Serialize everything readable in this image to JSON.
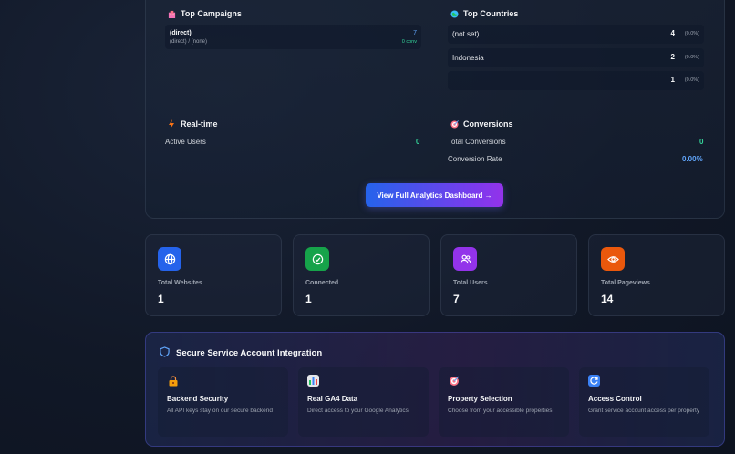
{
  "analytics": {
    "top_campaigns": {
      "title": "Top Campaigns",
      "rows": [
        {
          "name": "(direct)",
          "source": "(direct) / (none)",
          "value": "7",
          "conversions": "0 conv"
        }
      ]
    },
    "top_countries": {
      "title": "Top Countries",
      "rows": [
        {
          "name": "(not set)",
          "value": "4",
          "pct": "(0.0%)"
        },
        {
          "name": "Indonesia",
          "value": "2",
          "pct": "(0.0%)"
        },
        {
          "name": "",
          "value": "1",
          "pct": "(0.0%)"
        }
      ]
    },
    "realtime": {
      "title": "Real-time",
      "active_users_label": "Active Users",
      "active_users_value": "0"
    },
    "conversions": {
      "title": "Conversions",
      "total_label": "Total Conversions",
      "total_value": "0",
      "rate_label": "Conversion Rate",
      "rate_value": "0.00%"
    },
    "dashboard_button": "View Full Analytics Dashboard →"
  },
  "stats": [
    {
      "label": "Total Websites",
      "value": "1",
      "icon": "globe-icon",
      "color": "#2563eb"
    },
    {
      "label": "Connected",
      "value": "1",
      "icon": "check-circle-icon",
      "color": "#16a34a"
    },
    {
      "label": "Total Users",
      "value": "7",
      "icon": "users-icon",
      "color": "#9333ea"
    },
    {
      "label": "Total Pageviews",
      "value": "14",
      "icon": "eye-icon",
      "color": "#ea580c"
    }
  ],
  "secure": {
    "title": "Secure Service Account Integration",
    "features": [
      {
        "title": "Backend Security",
        "desc": "All API keys stay on our secure backend",
        "icon": "lock-icon"
      },
      {
        "title": "Real GA4 Data",
        "desc": "Direct access to your Google Analytics",
        "icon": "bar-chart-icon"
      },
      {
        "title": "Property Selection",
        "desc": "Choose from your accessible properties",
        "icon": "target-icon"
      },
      {
        "title": "Access Control",
        "desc": "Grant service account access per property",
        "icon": "refresh-icon"
      }
    ]
  },
  "colors": {
    "accent_blue": "#60a5fa",
    "accent_green": "#34d399",
    "button_start": "#2563eb",
    "button_end": "#9333ea"
  }
}
